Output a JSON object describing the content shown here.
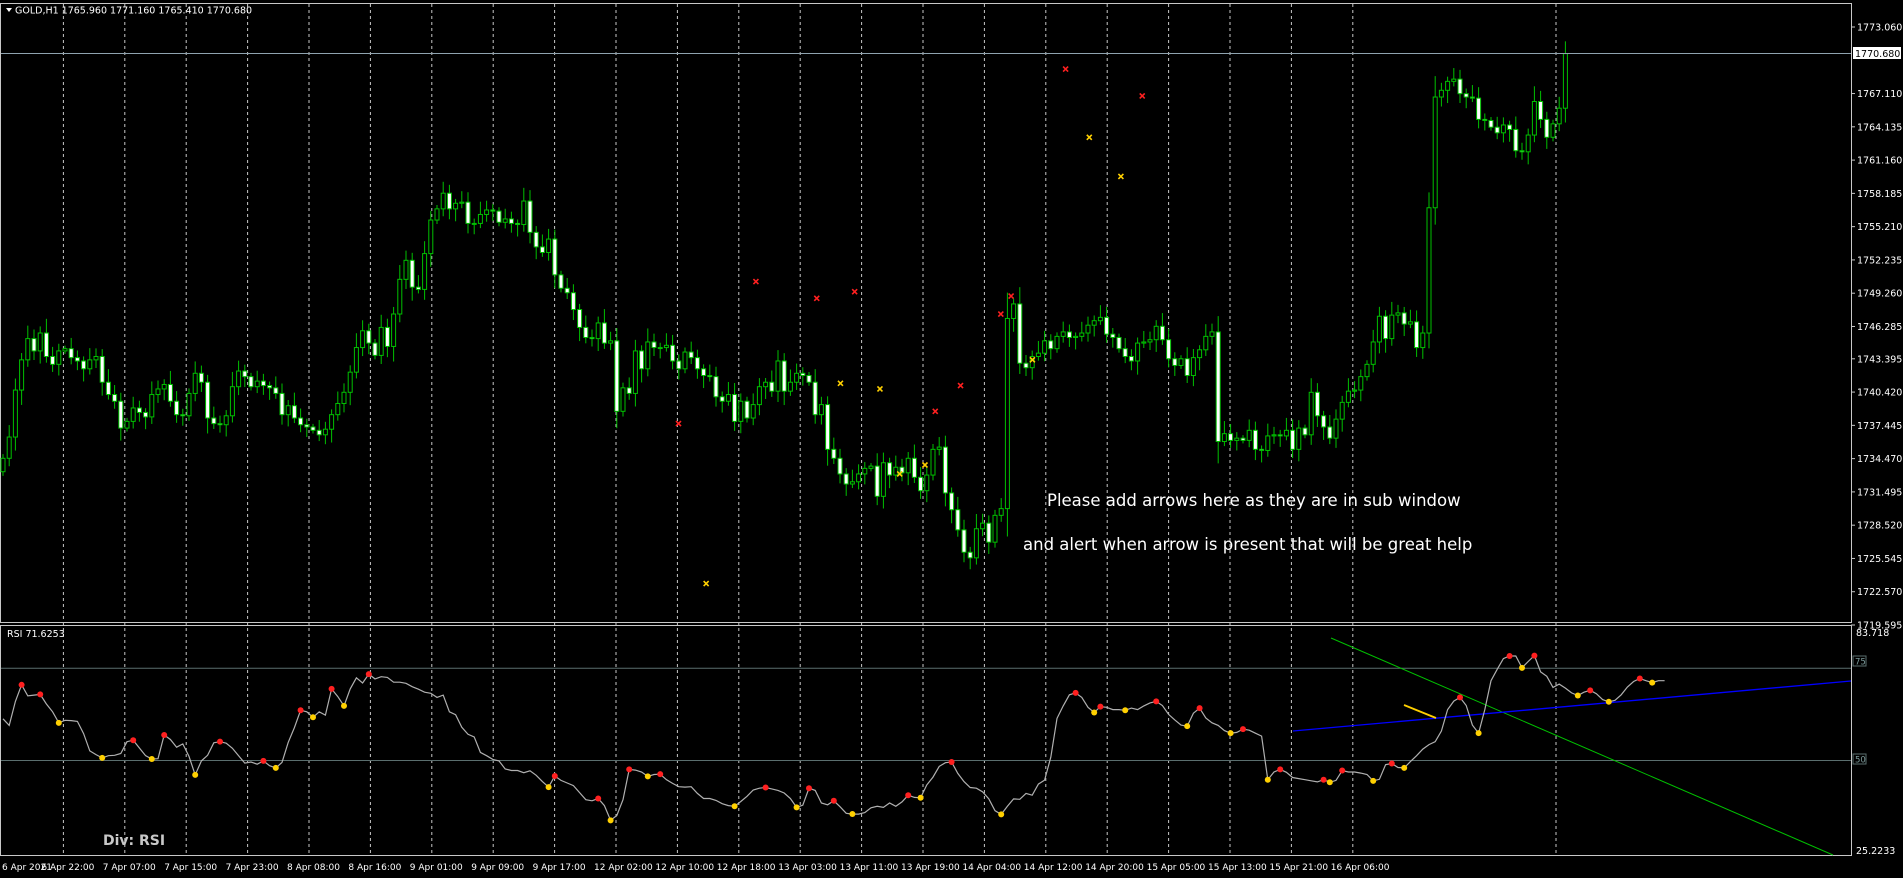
{
  "colors": {
    "background": "#000000",
    "frame": "#C8C8C8",
    "grid": "#C8C8C8",
    "text": "#FFFFFF",
    "candle": "#00C000",
    "bull_body": "#000000",
    "bear_body": "#FFFFFF",
    "sell_marker": "#FF2020",
    "buy_marker": "#FFD000",
    "rsi_line": "#B0B0B0",
    "level_line": "#5A6E6E",
    "price_line": "#8FA3AF",
    "trend_green": "#00C000",
    "trend_blue": "#0000FF",
    "trend_yellow": "#FFD000"
  },
  "main": {
    "symbol_label": "GOLD,H1  1765.960 1771.160 1765.410 1770.680",
    "price_axis": [
      "1773.060",
      "1767.110",
      "1764.135",
      "1761.160",
      "1758.185",
      "1755.210",
      "1752.235",
      "1749.260",
      "1746.285",
      "1743.395",
      "1740.420",
      "1737.445",
      "1734.470",
      "1731.495",
      "1728.520",
      "1725.545",
      "1722.570",
      "1719.595"
    ],
    "current_price": "1770.680",
    "annotation_line1": "Please add arrows here  as they are in sub window",
    "annotation_line2": "and alert when arrow is present that will be great help",
    "sell_markers": [
      {
        "t": 85,
        "p": 1737.6
      },
      {
        "t": 94.8,
        "p": 1750.3
      },
      {
        "t": 102.5,
        "p": 1748.8
      },
      {
        "t": 107.3,
        "p": 1749.4
      },
      {
        "t": 117.5,
        "p": 1738.7
      },
      {
        "t": 120.7,
        "p": 1741.0
      },
      {
        "t": 125.8,
        "p": 1747.4
      },
      {
        "t": 127.1,
        "p": 1749.0
      },
      {
        "t": 134,
        "p": 1769.3
      },
      {
        "t": 143.7,
        "p": 1766.9
      }
    ],
    "buy_markers": [
      {
        "t": 88.5,
        "p": 1723.3
      },
      {
        "t": 105.5,
        "p": 1741.2
      },
      {
        "t": 110.5,
        "p": 1740.7
      },
      {
        "t": 113,
        "p": 1733.1
      },
      {
        "t": 116.2,
        "p": 1733.9
      },
      {
        "t": 129.8,
        "p": 1743.3
      },
      {
        "t": 137,
        "p": 1763.2
      },
      {
        "t": 141,
        "p": 1759.7
      }
    ]
  },
  "rsi": {
    "label": "RSI 71.6253",
    "axis_top": "83.718",
    "axis_bottom": "25.2233",
    "level_high": "75",
    "level_low": "50",
    "div_label": "Div:  RSI"
  },
  "time_axis": [
    "6 Apr 2021",
    "6 Apr 22:00",
    "7 Apr 07:00",
    "7 Apr 15:00",
    "7 Apr 23:00",
    "8 Apr 08:00",
    "8 Apr 16:00",
    "9 Apr 01:00",
    "9 Apr 09:00",
    "9 Apr 17:00",
    "12 Apr 02:00",
    "12 Apr 10:00",
    "12 Apr 18:00",
    "13 Apr 03:00",
    "13 Apr 11:00",
    "13 Apr 19:00",
    "14 Apr 04:00",
    "14 Apr 12:00",
    "14 Apr 20:00",
    "15 Apr 05:00",
    "15 Apr 13:00",
    "15 Apr 21:00",
    "16 Apr 06:00"
  ],
  "chart_data": {
    "type": "candlestick",
    "title": "GOLD,H1",
    "close": [
      1734.5,
      1736.4,
      1740.6,
      1743.3,
      1745.2,
      1744.1,
      1745.7,
      1743.6,
      1742.9,
      1744.1,
      1744.3,
      1743.5,
      1743.2,
      1742.5,
      1743.3,
      1743.6,
      1741.3,
      1740.2,
      1739.6,
      1737.2,
      1737.8,
      1739.0,
      1738.6,
      1738.2,
      1740.2,
      1740.7,
      1741.1,
      1739.6,
      1738.4,
      1738.3,
      1740.3,
      1742.1,
      1741.3,
      1738.1,
      1737.6,
      1737.5,
      1738.3,
      1740.9,
      1742.3,
      1741.8,
      1740.9,
      1741.4,
      1741.0,
      1740.8,
      1740.3,
      1738.4,
      1739.2,
      1738.1,
      1737.5,
      1737.3,
      1737.0,
      1736.6,
      1737.1,
      1738.4,
      1739.4,
      1740.4,
      1742.2,
      1744.4,
      1745.9,
      1744.8,
      1743.7,
      1746.2,
      1744.5,
      1747.4,
      1750.5,
      1752.2,
      1749.8,
      1749.6,
      1752.8,
      1755.8,
      1756.8,
      1758.2,
      1756.8,
      1757.3,
      1757.4,
      1755.5,
      1755.5,
      1756.3,
      1756.7,
      1756.6,
      1755.6,
      1755.9,
      1755.5,
      1755.4,
      1757.5,
      1754.7,
      1753.4,
      1752.9,
      1754.1,
      1750.9,
      1749.7,
      1749.3,
      1747.8,
      1746.2,
      1745.3,
      1745.2,
      1746.6,
      1744.8,
      1745.0,
      1738.7,
      1740.8,
      1740.3,
      1744.1,
      1742.5,
      1744.9,
      1744.4,
      1744.4,
      1744.6,
      1743.2,
      1742.5,
      1744.0,
      1743.5,
      1742.5,
      1741.9,
      1741.8,
      1740.0,
      1739.6,
      1740.2,
      1737.8,
      1739.6,
      1738.1,
      1739.3,
      1740.9,
      1741.3,
      1740.5,
      1743.2,
      1740.5,
      1741.3,
      1742.1,
      1741.9,
      1741.3,
      1738.4,
      1739.3,
      1735.3,
      1734.5,
      1733.1,
      1732.2,
      1732.4,
      1733.1,
      1733.6,
      1733.8,
      1731.1,
      1734.1,
      1733.0,
      1733.7,
      1733.2,
      1734.5,
      1732.8,
      1731.6,
      1733.0,
      1735.3,
      1735.5,
      1731.4,
      1729.9,
      1728.1,
      1726.1,
      1725.6,
      1728.2,
      1728.7,
      1727.0,
      1729.4,
      1730.0,
      1747.0,
      1748.3,
      1743.0,
      1742.6,
      1743.6,
      1743.9,
      1745.0,
      1744.3,
      1745.4,
      1745.8,
      1745.3,
      1745.4,
      1745.7,
      1746.4,
      1746.8,
      1747.1,
      1745.6,
      1745.3,
      1744.3,
      1743.6,
      1743.2,
      1744.8,
      1744.9,
      1745.1,
      1746.3,
      1745.1,
      1743.4,
      1742.8,
      1743.4,
      1741.9,
      1743.5,
      1744.2,
      1745.4,
      1745.8,
      1736.0,
      1736.7,
      1736.1,
      1736.3,
      1736.1,
      1737.0,
      1735.3,
      1735.2,
      1736.5,
      1736.6,
      1736.5,
      1737.0,
      1735.3,
      1737.2,
      1736.6,
      1740.4,
      1738.3,
      1737.3,
      1736.3,
      1738.0,
      1739.5,
      1740.5,
      1740.6,
      1741.8,
      1742.9,
      1744.9,
      1747.2,
      1745.2,
      1747.3,
      1747.5,
      1746.5,
      1746.7,
      1744.4,
      1745.7,
      1756.9,
      1766.8,
      1767.4,
      1768.2,
      1768.4,
      1767.1,
      1766.8,
      1766.7,
      1764.8,
      1764.7,
      1764.1,
      1763.6,
      1764.3,
      1763.9,
      1762.0,
      1761.9,
      1763.4,
      1766.4,
      1764.8,
      1763.2,
      1764.4,
      1765.8,
      1770.68
    ],
    "price_range": [
      1719.595,
      1773.06
    ],
    "rsi": [
      61.3,
      59.5,
      66,
      70.5,
      67.5,
      67.7,
      67.9,
      65.3,
      63.2,
      60.2,
      60.9,
      60.8,
      60.6,
      57.3,
      52.6,
      51.6,
      50.7,
      51.3,
      51.4,
      51.9,
      55.1,
      55.5,
      53.4,
      51.3,
      50.4,
      50.5,
      56.9,
      55.7,
      53.6,
      54.5,
      51.1,
      46.1,
      49.9,
      51.4,
      54.8,
      55.1,
      54.7,
      53.3,
      51.3,
      49.3,
      49.6,
      49,
      49.9,
      48.6,
      48,
      49.5,
      54.9,
      58.9,
      63.6,
      63.2,
      61.7,
      63.2,
      62.3,
      69.4,
      67.3,
      64.8,
      69.4,
      72.4,
      71,
      73.4,
      72.1,
      72.7,
      72.5,
      71.2,
      71.2,
      70.9,
      70,
      69.3,
      68.5,
      68.2,
      67.1,
      67.7,
      63.2,
      62.4,
      59,
      57.1,
      56.4,
      52.2,
      51.3,
      50.3,
      49.9,
      47.7,
      47.3,
      47.3,
      46.7,
      47.2,
      46,
      44.3,
      42.8,
      45.8,
      44.6,
      43.9,
      43.2,
      41.3,
      39.4,
      39.1,
      39.7,
      37.8,
      33.8,
      35.1,
      39.4,
      47.6,
      47.4,
      46.9,
      45.7,
      46.2,
      46.3,
      44.8,
      43.8,
      42.9,
      42.8,
      42.9,
      41.1,
      39.7,
      39.7,
      39.2,
      38.3,
      37.8,
      37.6,
      38.9,
      40.3,
      42,
      42.5,
      42.7,
      42.3,
      41.9,
      41.2,
      39.7,
      37.3,
      37.9,
      42.5,
      41.9,
      38.5,
      38,
      39.1,
      37.5,
      35.7,
      35.5,
      35.5,
      35.9,
      37.2,
      37.6,
      37.3,
      38.5,
      37.6,
      38.8,
      40.6,
      40,
      39.9,
      43.4,
      45.5,
      48.4,
      49.4,
      49.6,
      46.5,
      44.3,
      42.7,
      42.5,
      41.5,
      39.6,
      36.4,
      35.4,
      37.6,
      39.6,
      39.5,
      41.1,
      40.6,
      43.6,
      44.7,
      50.9,
      61.4,
      64.8,
      67.8,
      68.3,
      67.1,
      64.4,
      63,
      64.6,
      64.4,
      63.8,
      63.8,
      63.6,
      64.2,
      63.8,
      64.8,
      65.6,
      66,
      64.9,
      62.5,
      61,
      59.6,
      59.3,
      62.8,
      64.2,
      61.5,
      60.2,
      59.5,
      58.1,
      57.4,
      57.6,
      58.5,
      58.2,
      57.4,
      56.6,
      44.8,
      46.9,
      47.6,
      46.8,
      45.4,
      45.1,
      44.8,
      44.5,
      44.2,
      44.8,
      44.1,
      44.6,
      47.3,
      46.9,
      46.9,
      46.6,
      46.2,
      44.5,
      44.9,
      48.9,
      49.2,
      48.1,
      48,
      49.7,
      51.3,
      53.1,
      54.3,
      55.1,
      58,
      63.8,
      66.1,
      67.1,
      64.9,
      59.6,
      57.4,
      63.8,
      71.6,
      74.7,
      77.6,
      78.3,
      78.3,
      75.1,
      76.8,
      78.4,
      74,
      72.8,
      69.8,
      70.7,
      69.6,
      68.3,
      67.6,
      68.5,
      69,
      68.1,
      66.5,
      65.9,
      66.3,
      67.8,
      69.9,
      71.4,
      72.2,
      71.6,
      71.1,
      71.6,
      71.6
    ],
    "rsi_range": [
      25.2233,
      83.718
    ],
    "rsi_levels": [
      75,
      50
    ]
  }
}
